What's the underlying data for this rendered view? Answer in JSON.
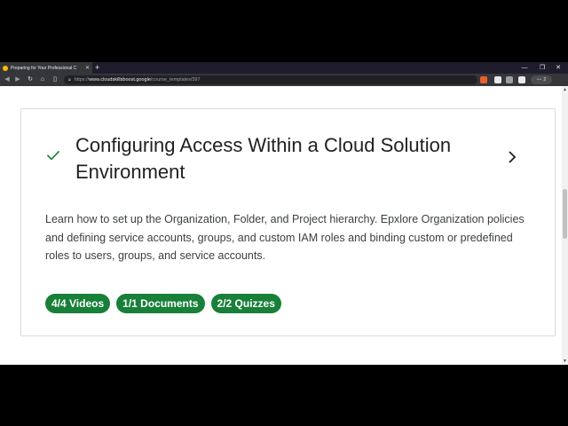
{
  "browser": {
    "tab": {
      "title": "Preparing for Your Professional C",
      "close": "✕"
    },
    "new_tab": "+",
    "window_controls": {
      "minimize": "—",
      "restore": "❐",
      "close": "✕"
    },
    "address": {
      "scheme": "https://",
      "host": "www.cloudskillsboost.google",
      "path": "/course_templates/397"
    },
    "profile_count": "2",
    "colors": {
      "tabstrip": "#1f1d2b",
      "toolbar": "#35363a",
      "omnibox": "#202124"
    }
  },
  "module": {
    "title": "Configuring Access Within a Cloud Solution Environment",
    "description": "Learn how to set up the Organization, Folder, and Project hierarchy. Epxlore Organization policies and defining service accounts, groups, and custom IAM roles and binding custom or predefined roles to users, groups, and service accounts.",
    "chips": [
      "4/4 Videos",
      "1/1 Documents",
      "2/2 Quizzes"
    ],
    "colors": {
      "chip_bg": "#188038",
      "check": "#188038",
      "title": "#202124",
      "text": "#3c4043"
    }
  }
}
